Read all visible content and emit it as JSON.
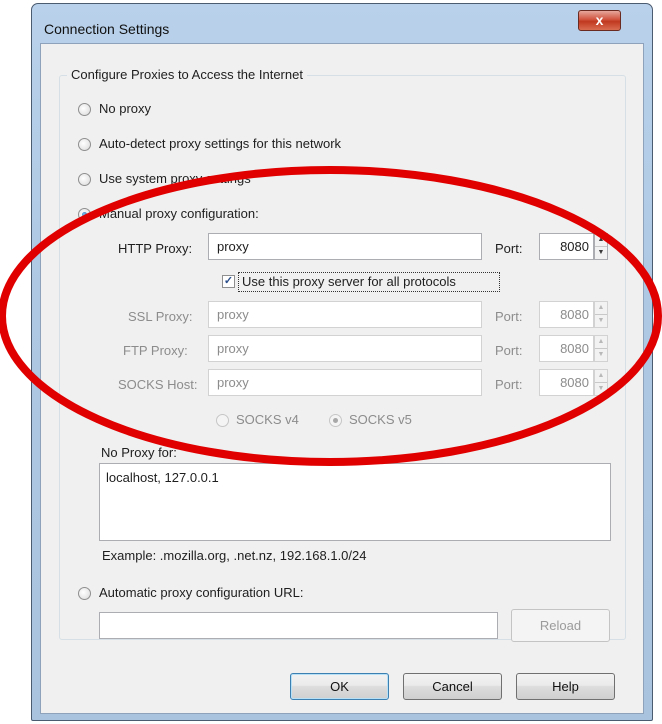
{
  "window": {
    "title": "Connection Settings",
    "close_glyph": "x"
  },
  "group": {
    "title": "Configure Proxies to Access the Internet"
  },
  "proxy_modes": {
    "no_proxy": "No proxy",
    "auto_detect": "Auto-detect proxy settings for this network",
    "system": "Use system proxy settings",
    "manual": "Manual proxy configuration:",
    "pac": "Automatic proxy configuration URL:"
  },
  "http": {
    "label": "HTTP Proxy:",
    "value": "proxy",
    "port_label": "Port:",
    "port": "8080"
  },
  "share": {
    "label": "Use this proxy server for all protocols",
    "checked": true
  },
  "ssl": {
    "label": "SSL Proxy:",
    "value": "proxy",
    "port_label": "Port:",
    "port": "8080"
  },
  "ftp": {
    "label": "FTP Proxy:",
    "value": "proxy",
    "port_label": "Port:",
    "port": "8080"
  },
  "socks": {
    "label": "SOCKS Host:",
    "value": "proxy",
    "port_label": "Port:",
    "port": "8080",
    "v4": "SOCKS v4",
    "v5": "SOCKS v5"
  },
  "no_proxy_for": {
    "label": "No Proxy for:",
    "value": "localhost, 127.0.0.1"
  },
  "example": "Example: .mozilla.org, .net.nz, 192.168.1.0/24",
  "pac": {
    "value": "",
    "reload": "Reload"
  },
  "buttons": {
    "ok": "OK",
    "cancel": "Cancel",
    "help": "Help"
  },
  "annotation": {
    "color": "#e00000"
  },
  "icons": {
    "spin_up": "▲",
    "spin_down": "▼",
    "check": "✓"
  }
}
